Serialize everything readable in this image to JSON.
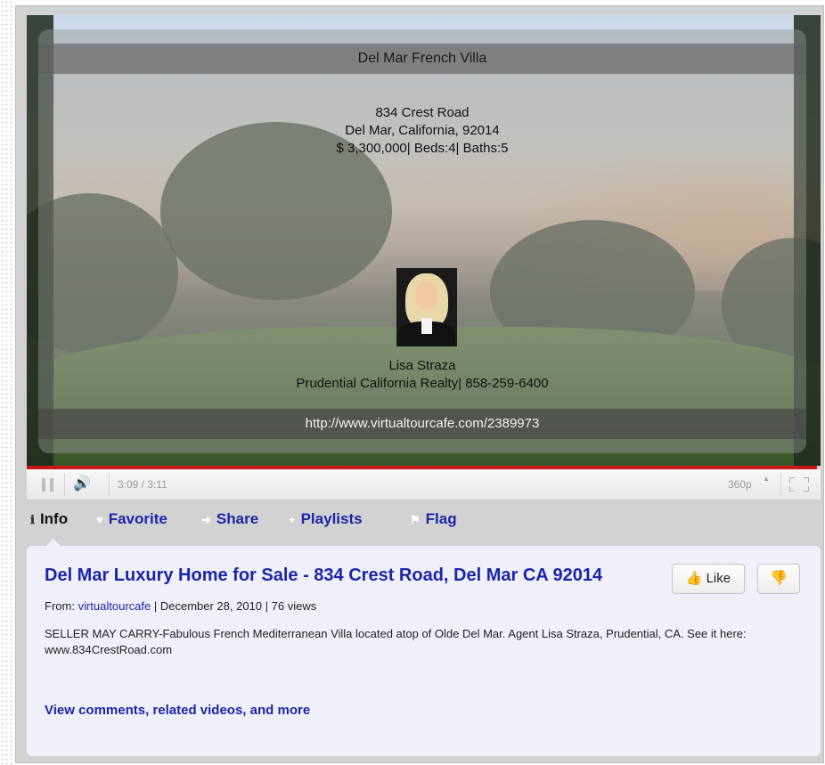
{
  "video": {
    "banner_title": "Del Mar  French Villa",
    "address_line1": "834 Crest Road",
    "address_line2": "Del Mar, California, 92014",
    "price_line": "$ 3,300,000| Beds:4| Baths:5",
    "agent_name": "Lisa Straza",
    "agent_company": "Prudential California Realty| 858-259-6400",
    "tour_url": "http://www.virtualtourcafe.com/2389973",
    "progress_fraction": 0.995
  },
  "controls": {
    "time": "3:09 / 3:11",
    "quality": "360p",
    "pause_icon": "pause-icon",
    "volume_icon": "volume-icon",
    "fullscreen_icon": "fullscreen-icon"
  },
  "tabs": [
    {
      "label": "Info",
      "icon": "ℹ",
      "active": true
    },
    {
      "label": "Favorite",
      "icon": "♥",
      "active": false
    },
    {
      "label": "Share",
      "icon": "➜",
      "active": false
    },
    {
      "label": "Playlists",
      "icon": "+",
      "active": false
    },
    {
      "label": "Flag",
      "icon": "⚑",
      "active": false
    }
  ],
  "info": {
    "title": "Del Mar Luxury Home for Sale - 834 Crest Road, Del Mar CA 92014",
    "like_label": "Like",
    "from_prefix": "From:",
    "channel": "virtualtourcafe",
    "date": "| December 28, 2010",
    "views": " | 76 views",
    "description": "SELLER MAY CARRY-Fabulous French Mediterranean Villa located atop of Olde Del Mar. Agent Lisa Straza, Prudential, CA. See it here: www.834CrestRoad.com",
    "more_link": "View comments, related videos, and more"
  },
  "colors": {
    "link": "#1a25a8",
    "progress": "#cc1a1a",
    "panel_bg": "#f0f0fb"
  }
}
